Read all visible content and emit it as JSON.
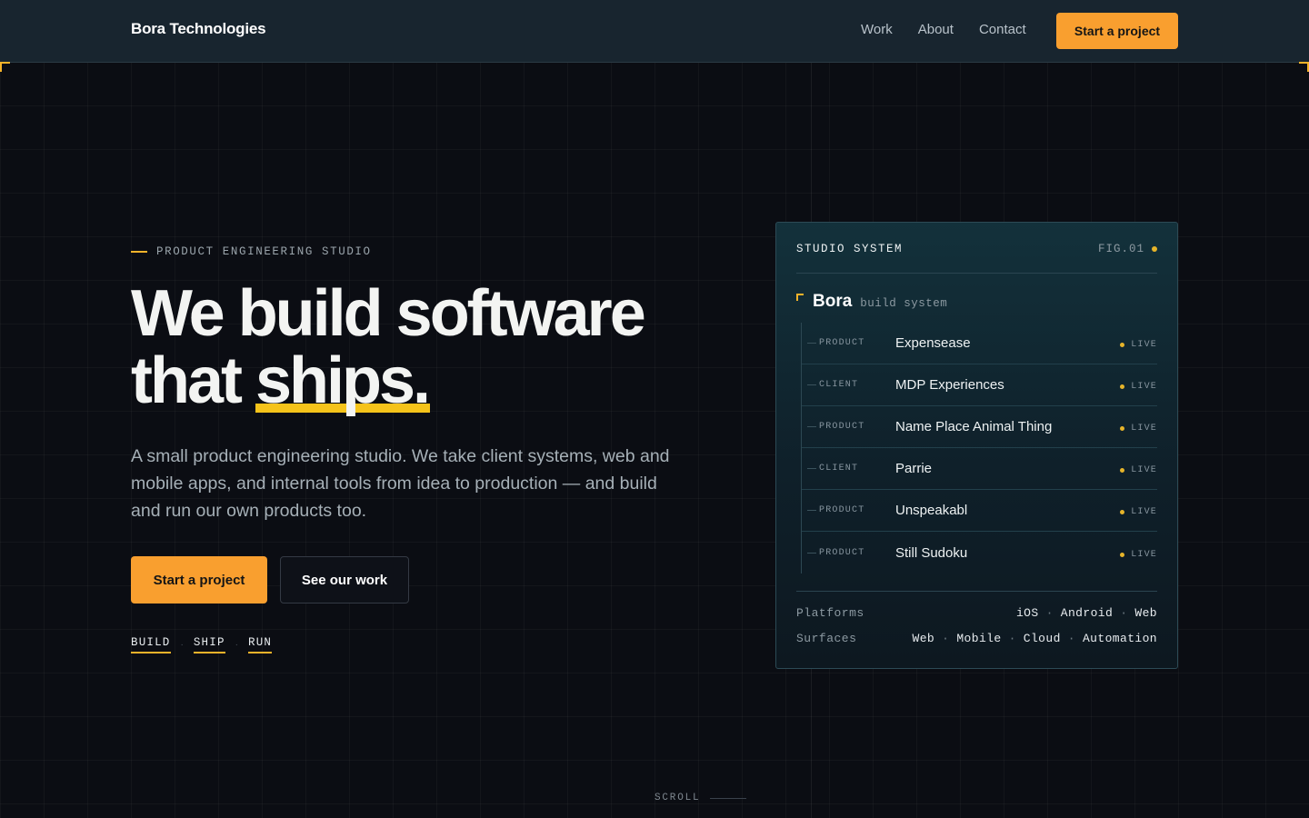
{
  "nav": {
    "brand": "Bora Technologies",
    "links": [
      {
        "label": "Work"
      },
      {
        "label": "About"
      },
      {
        "label": "Contact"
      }
    ],
    "cta": "Start a project"
  },
  "hero": {
    "eyebrow": "PRODUCT ENGINEERING STUDIO",
    "headline_line1": "We build software",
    "headline_line2_prefix": "that ",
    "headline_highlight": "ships.",
    "lead": "A small product engineering studio. We take client systems, web and mobile apps, and internal tools from idea to production — and build and run our own products too.",
    "primary_cta": "Start a project",
    "secondary_cta": "See our work",
    "steps": [
      {
        "label": "BUILD"
      },
      {
        "label": "SHIP"
      },
      {
        "label": "RUN"
      }
    ]
  },
  "card": {
    "title": "STUDIO SYSTEM",
    "fig": "FIG.01",
    "system_name": "Bora",
    "system_sub": "build system",
    "items": [
      {
        "kind": "PRODUCT",
        "name": "Expensease",
        "status": "LIVE"
      },
      {
        "kind": "CLIENT",
        "name": "MDP Experiences",
        "status": "LIVE"
      },
      {
        "kind": "PRODUCT",
        "name": "Name Place Animal Thing",
        "status": "LIVE"
      },
      {
        "kind": "CLIENT",
        "name": "Parrie",
        "status": "LIVE"
      },
      {
        "kind": "PRODUCT",
        "name": "Unspeakabl",
        "status": "LIVE"
      },
      {
        "kind": "PRODUCT",
        "name": "Still Sudoku",
        "status": "LIVE"
      }
    ],
    "platforms_label": "Platforms",
    "platforms": [
      "iOS",
      "Android",
      "Web"
    ],
    "surfaces_label": "Surfaces",
    "surfaces": [
      "Web",
      "Mobile",
      "Cloud",
      "Automation"
    ],
    "separator": "·"
  },
  "scroll_label": "SCROLL",
  "colors": {
    "accent": "#f99f2f",
    "highlight": "#f5c31a",
    "live_dot": "#e6b42a",
    "background": "#0b0d13"
  }
}
